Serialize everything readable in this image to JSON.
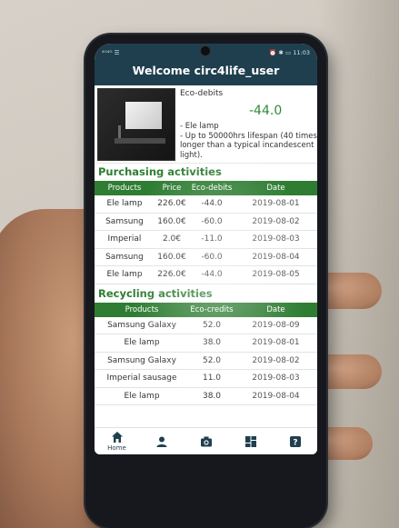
{
  "status_bar": {
    "left": "⁴ᴳ⁴ᴳ ☰",
    "right": "⏰ ✱ ▭ 11:03"
  },
  "header": {
    "title": "Welcome circ4life_user"
  },
  "product": {
    "debits_label": "Eco-debits",
    "debits_value": "-44.0",
    "description": "- Ele lamp\n- Up to 50000hrs lifespan (40 times longer than a typical incandescent light)."
  },
  "purchasing": {
    "title": "Purchasing activities",
    "columns": [
      "Products",
      "Price",
      "Eco-debits",
      "Date"
    ],
    "rows": [
      [
        "Ele lamp",
        "226.0€",
        "-44.0",
        "2019-08-01"
      ],
      [
        "Samsung",
        "160.0€",
        "-60.0",
        "2019-08-02"
      ],
      [
        "Imperial",
        "2.0€",
        "-11.0",
        "2019-08-03"
      ],
      [
        "Samsung",
        "160.0€",
        "-60.0",
        "2019-08-04"
      ],
      [
        "Ele lamp",
        "226.0€",
        "-44.0",
        "2019-08-05"
      ]
    ]
  },
  "recycling": {
    "title": "Recycling activities",
    "columns": [
      "Products",
      "Eco-credits",
      "Date"
    ],
    "rows": [
      [
        "Samsung Galaxy",
        "52.0",
        "2019-08-09"
      ],
      [
        "Ele lamp",
        "38.0",
        "2019-08-01"
      ],
      [
        "Samsung Galaxy",
        "52.0",
        "2019-08-02"
      ],
      [
        "Imperial sausage",
        "11.0",
        "2019-08-03"
      ],
      [
        "Ele lamp",
        "38.0",
        "2019-08-04"
      ]
    ]
  },
  "nav": {
    "home_label": "Home"
  },
  "colors": {
    "app_bar": "#1f3f4f",
    "section_green": "#2e7d32",
    "debit_green": "#2e8b3a"
  }
}
